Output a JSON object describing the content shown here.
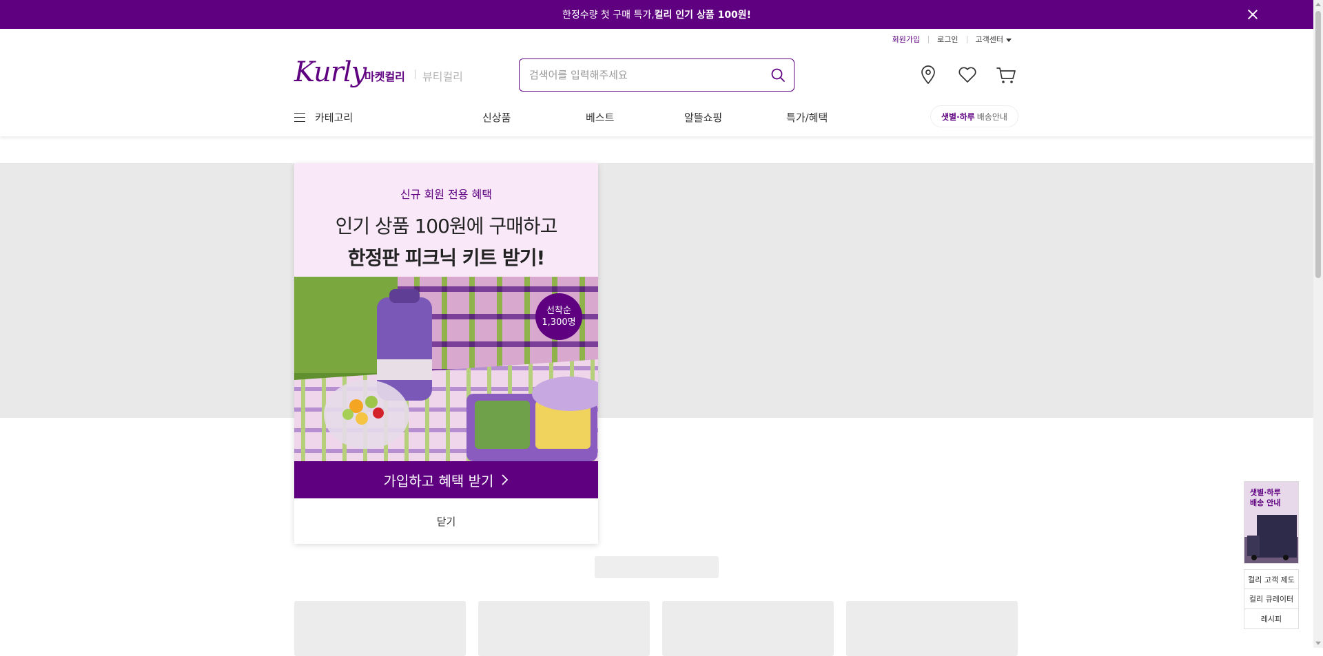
{
  "top_banner": {
    "text_prefix": "한정수량 첫 구매 특가, ",
    "text_bold": "컬리 인기 상품 100원!",
    "close_icon": "close-icon"
  },
  "utility_menu": {
    "signup": "회원가입",
    "login": "로그인",
    "customer_center": "고객센터"
  },
  "header": {
    "logo_text": "Kurly",
    "tab_market": "마켓컬리",
    "tab_beauty": "뷰티컬리",
    "search_placeholder": "검색어를 입력해주세요",
    "icons": [
      "map-pin-icon",
      "heart-icon",
      "cart-icon"
    ]
  },
  "gnb": {
    "category_label": "카테고리",
    "menu": [
      "신상품",
      "베스트",
      "알뜰쇼핑",
      "특가/혜택"
    ],
    "delivery_bold": "샛별·하루",
    "delivery_text": "배송안내"
  },
  "popup": {
    "eyebrow": "신규 회원 전용 혜택",
    "headline_1": "인기 상품 100원에 구매하고",
    "headline_2": "한정판 피크닉 키트 받기!",
    "badge_line1": "선착순",
    "badge_line2": "1,300명",
    "cta_label": "가입하고 혜택 받기",
    "close_label": "닫기"
  },
  "side_banner": {
    "ad_text_1": "샛별·하루",
    "ad_text_2": "배송 안내",
    "links": [
      "컬리 고객 제도",
      "컬리 큐레이터",
      "레시피"
    ]
  },
  "colors": {
    "brand_purple": "#5f0080",
    "hero_gray": "#e9e9e9",
    "popup_head_bg": "#f8e8f8"
  }
}
